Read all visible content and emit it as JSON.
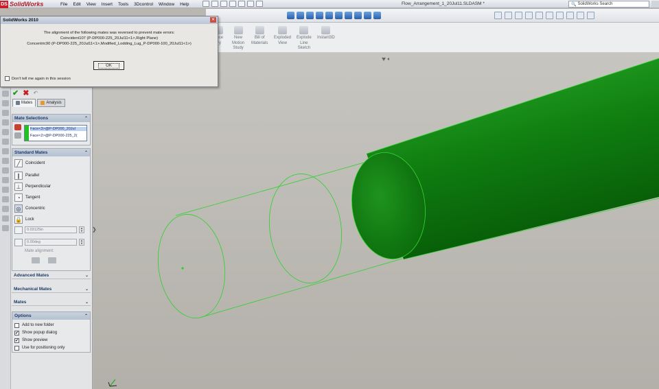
{
  "titlebar": {
    "app_name": "SolidWorks",
    "ds_mark": "DS",
    "menu": [
      "File",
      "Edit",
      "View",
      "Insert",
      "Tools",
      "3Dcontrol",
      "Window",
      "Help"
    ],
    "document_title": "Flow_Arrangement_1_20Jul11.SLDASM *",
    "search_placeholder": "SolidWorks Search"
  },
  "command_manager": {
    "items": [
      {
        "label": "ence\ntry"
      },
      {
        "label": "New\nMotion\nStudy"
      },
      {
        "label": "Bill of\nMaterials"
      },
      {
        "label": "Exploded\nView"
      },
      {
        "label": "Explode\nLine\nSketch"
      },
      {
        "label": "Instant3D"
      }
    ]
  },
  "dialog": {
    "title": "SolidWorks 2010",
    "line1": "The alignment of the following mates was reversed to prevent mate errors:",
    "line2": "Coincident107 (P-DP000-225_20Jul11<1>,Right Plane)",
    "line3": "Concentric90 (P-DP000-225_20Jul11<1>,Modified_Lodding_Lug_P-DP000-100_20Jul11<1>)",
    "ok_label": "OK",
    "dont_tell_label": "Don't tell me again in this session"
  },
  "property_manager": {
    "tabs": [
      "Mates",
      "Analysis"
    ],
    "mate_selections": {
      "title": "Mate Selections",
      "items": [
        "Face<3>@P-DP000_20Jul",
        "Face<2>@P-DP000-225_2("
      ]
    },
    "standard_mates": {
      "title": "Standard Mates",
      "items": [
        "Coincident",
        "Parallel",
        "Perpendicular",
        "Tangent",
        "Concentric",
        "Lock"
      ],
      "distance_value": "0.03125in",
      "angle_value": "0.00deg",
      "mate_alignment_label": "Mate alignment:"
    },
    "collapsed_groups": [
      "Advanced Mates",
      "Mechanical Mates",
      "Mates"
    ],
    "options": {
      "title": "Options",
      "items": [
        {
          "label": "Add to new folder",
          "checked": false
        },
        {
          "label": "Show popup dialog",
          "checked": true
        },
        {
          "label": "Show preview",
          "checked": true
        },
        {
          "label": "Use for positioning only",
          "checked": false
        }
      ]
    }
  },
  "colors": {
    "part_green": "#1a8c1a",
    "wire_green": "#2bd12b",
    "selection_green": "#22c022"
  }
}
